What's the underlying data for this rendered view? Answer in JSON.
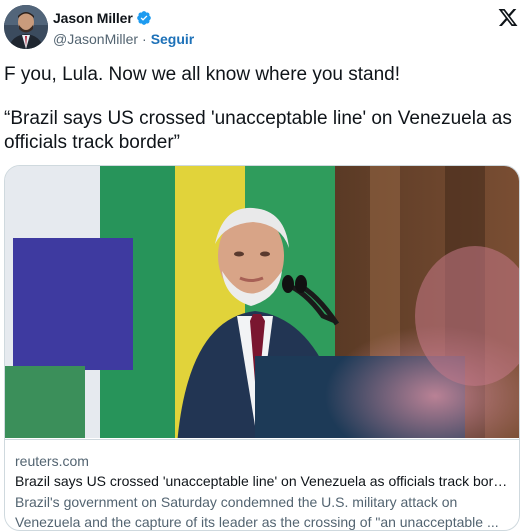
{
  "author": {
    "display_name": "Jason Miller",
    "handle": "@JasonMiller",
    "separator": "·",
    "follow_label": "Seguir",
    "verified_color": "#1d9bf0"
  },
  "platform_icon": "x-logo-icon",
  "tweet": {
    "line1": "F you, Lula. Now we all know where you stand!",
    "line2": "“Brazil says US crossed 'unacceptable line' on Venezuela as officials track border”"
  },
  "link_card": {
    "domain": "reuters.com",
    "title": "Brazil says US crossed 'unacceptable line' on Venezuela as officials track border",
    "description": "Brazil's government on Saturday condemned the U.S. military attack on Venezuela and the capture of its leader as the crossing of \"an unacceptable ..."
  }
}
